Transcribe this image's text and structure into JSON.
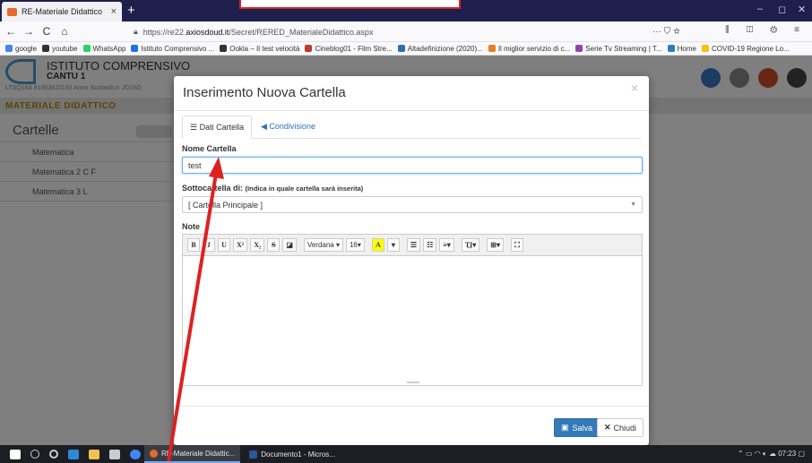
{
  "browser": {
    "tab_title": "RE-Materiale Didattico",
    "tab_close": "×",
    "new_tab": "+",
    "url_prefix": "https://re22.",
    "url_domain": "axiosdoud.it",
    "url_path": "/Secret/RERED_MaterialeDidattico.aspx",
    "url_actions": "··· ⛉ ☆",
    "nav_back": "←",
    "nav_forward": "→",
    "nav_reload": "C",
    "nav_home": "⌂",
    "nav_right": "⫼ ◫ ⚙ ≡",
    "win_min": "–",
    "win_max": "◻",
    "win_close": "✕"
  },
  "bookmarks": [
    {
      "label": "google",
      "color": "#4285f4"
    },
    {
      "label": "youtube",
      "color": "#333333"
    },
    {
      "label": "WhatsApp",
      "color": "#25d366"
    },
    {
      "label": "Istituto Comprensivo ...",
      "color": "#1a73e8"
    },
    {
      "label": "Ookla – Il test velocità",
      "color": "#333333"
    },
    {
      "label": "Cineblog01 - Film Stre...",
      "color": "#c0392b"
    },
    {
      "label": "Altadefinizione (2020)...",
      "color": "#2d6fb5"
    },
    {
      "label": "Il miglior servizio di c...",
      "color": "#e67e22"
    },
    {
      "label": "Serie Tv Streaming | T...",
      "color": "#8e44ad"
    },
    {
      "label": "Home",
      "color": "#2980b9"
    },
    {
      "label": "COVID-19 Regione Lo...",
      "color": "#f1c40f"
    }
  ],
  "page": {
    "school_name": "ISTITUTO COMPRENSIVO",
    "school_sub": "CANTU 1",
    "school_code": "LTSQ18A   81003810132      Anno Scolastico: 2019/2",
    "section_title": "MATERIALE DIDATTICO",
    "panel_title": "Cartelle",
    "folders": [
      "Matematica",
      "Matematica 2 C F",
      "Matematica 3 L"
    ]
  },
  "modal": {
    "title": "Inserimento Nuova Cartella",
    "close": "×",
    "tab_data": "Dati Cartella",
    "tab_share": "Condivisione",
    "name_label": "Nome Cartella",
    "name_value": "test",
    "parent_label": "Sottocartella di:",
    "parent_hint": "(Indica in quale cartella sarà inserita)",
    "parent_value": "[ Cartella Principale ]",
    "notes_label": "Note",
    "toolbar": {
      "bold": "B",
      "italic": "I",
      "underline": "U",
      "superscript": "X²",
      "subscript": "X₂",
      "strike": "S",
      "eraser": "◪",
      "font": "Verdana ▾",
      "size": "16▾",
      "color": "A",
      "color_arrow": "▾",
      "ul": "☰",
      "ol": "☷",
      "align": "≡▾",
      "style": "T͟I▾",
      "table": "⊞▾",
      "fullscreen": "⛶"
    },
    "save_label": "Salva",
    "close_label": "Chiudi"
  },
  "taskbar": {
    "app_browser": "RE-Materiale Didattic...",
    "app_word": "Documento1 - Micros...",
    "time": "07:23"
  },
  "colors": {
    "accent": "#337ab7",
    "annotation": "#e02020",
    "section_title": "#b8860b"
  }
}
